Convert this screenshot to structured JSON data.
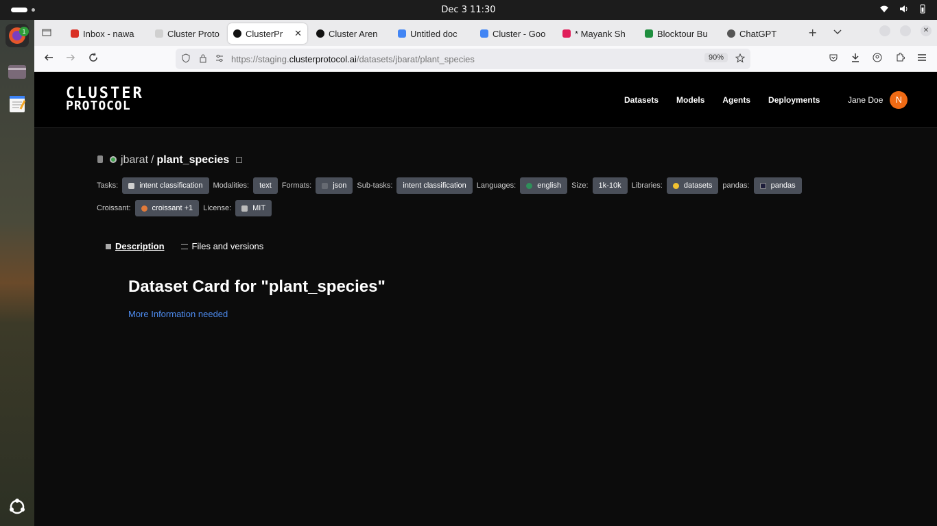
{
  "system_bar": {
    "clock": "Dec 3  11:30"
  },
  "dock": {
    "firefox_badge": "1"
  },
  "tabs": [
    {
      "label": "Inbox - nawa",
      "fav_color": "#d93025"
    },
    {
      "label": "Cluster Proto",
      "fav_color": "#d0d0d0"
    },
    {
      "label": "ClusterPr",
      "fav_color": "#111111",
      "active": true
    },
    {
      "label": "Cluster Aren",
      "fav_color": "#111111"
    },
    {
      "label": "Untitled doc",
      "fav_color": "#4285f4"
    },
    {
      "label": "Cluster - Goo",
      "fav_color": "#4285f4"
    },
    {
      "label": "* Mayank Sh",
      "fav_color": "#e01e5a"
    },
    {
      "label": "Blocktour Bu",
      "fav_color": "#1e8e3e"
    },
    {
      "label": "ChatGPT",
      "fav_color": "#555555"
    }
  ],
  "address": {
    "scheme": "https://staging.",
    "domain": "clusterprotocol.ai",
    "path": "/datasets/jbarat/plant_species",
    "zoom": "90%"
  },
  "site": {
    "logo_line1": "CLUSTER",
    "logo_line2": "PROTOCOL",
    "nav": [
      "Datasets",
      "Models",
      "Agents",
      "Deployments"
    ],
    "user_name": "Jane Doe",
    "user_initial": "N"
  },
  "dataset": {
    "owner": "jbarat",
    "separator": "/",
    "name": "plant_species",
    "row1": [
      {
        "label": "Tasks:",
        "value": "intent classification",
        "ic": "#cfcfcf"
      },
      {
        "label": "Modalities:",
        "value": "text",
        "ic": ""
      },
      {
        "label": "Formats:",
        "value": "json",
        "ic": "#666a72"
      },
      {
        "label": "Sub-tasks:",
        "value": "intent classification",
        "ic": ""
      },
      {
        "label": "Languages:",
        "value": "english",
        "ic": "#2f8f5a"
      },
      {
        "label": "Size:",
        "value": "1k-10k",
        "ic": ""
      },
      {
        "label": "Libraries:",
        "value": "datasets",
        "ic": "#f2c230"
      },
      {
        "label": "pandas:",
        "value": "pandas",
        "ic": "#1d1d3a"
      }
    ],
    "row2": [
      {
        "label": "Croissant:",
        "value": "croissant +1",
        "ic": "#e07a3a"
      },
      {
        "label": "License:",
        "value": "MIT",
        "ic": "#bbbbbb"
      }
    ],
    "subtabs": [
      "Description",
      "Files and versions"
    ],
    "card_title": "Dataset Card for \"plant_species\"",
    "card_link": "More Information needed"
  }
}
